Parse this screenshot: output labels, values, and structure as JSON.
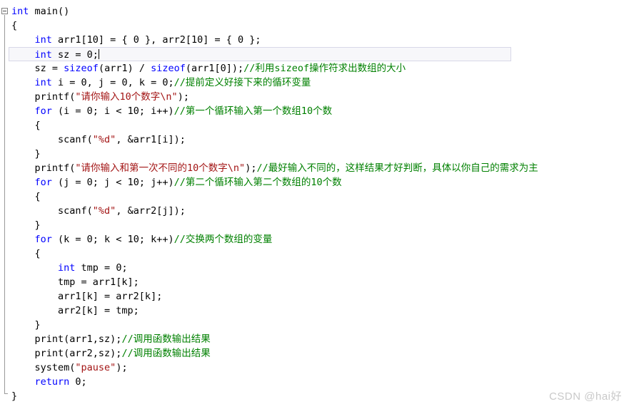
{
  "editor": {
    "language": "c",
    "colors": {
      "background": "#ffffff",
      "text": "#000000",
      "keyword": "#0000ff",
      "string": "#a31515",
      "comment": "#008000",
      "gutter_line": "#9a9a9a",
      "current_line_border": "#d8d8e8",
      "watermark": "#c9c9c9"
    },
    "outlining": {
      "collapse_label": "-",
      "expanded": true
    },
    "cursor": {
      "line": 4,
      "column": 16
    }
  },
  "watermark": {
    "text": "CSDN @hai好"
  },
  "lines": [
    {
      "n": 1,
      "tokens": [
        {
          "t": "kw",
          "s": "int"
        },
        {
          "t": "plain",
          "s": " main()"
        }
      ]
    },
    {
      "n": 2,
      "tokens": [
        {
          "t": "plain",
          "s": "{"
        }
      ]
    },
    {
      "n": 3,
      "tokens": [
        {
          "t": "plain",
          "s": "    "
        },
        {
          "t": "kw",
          "s": "int"
        },
        {
          "t": "plain",
          "s": " arr1[10] = { 0 }, arr2[10] = { 0 };"
        }
      ]
    },
    {
      "n": 4,
      "current": true,
      "tokens": [
        {
          "t": "plain",
          "s": "    "
        },
        {
          "t": "kw",
          "s": "int"
        },
        {
          "t": "plain",
          "s": " sz = 0;"
        }
      ]
    },
    {
      "n": 5,
      "tokens": [
        {
          "t": "plain",
          "s": "    sz = "
        },
        {
          "t": "kw",
          "s": "sizeof"
        },
        {
          "t": "plain",
          "s": "(arr1) / "
        },
        {
          "t": "kw",
          "s": "sizeof"
        },
        {
          "t": "plain",
          "s": "(arr1[0]);"
        },
        {
          "t": "cmt",
          "s": "//利用sizeof操作符求出数组的大小"
        }
      ]
    },
    {
      "n": 6,
      "tokens": [
        {
          "t": "plain",
          "s": "    "
        },
        {
          "t": "kw",
          "s": "int"
        },
        {
          "t": "plain",
          "s": " i = 0, j = 0, k = 0;"
        },
        {
          "t": "cmt",
          "s": "//提前定义好接下来的循环变量"
        }
      ]
    },
    {
      "n": 7,
      "tokens": [
        {
          "t": "plain",
          "s": "    printf("
        },
        {
          "t": "str",
          "s": "\"请你输入10个数字\\n\""
        },
        {
          "t": "plain",
          "s": ");"
        }
      ]
    },
    {
      "n": 8,
      "tokens": [
        {
          "t": "plain",
          "s": "    "
        },
        {
          "t": "kw",
          "s": "for"
        },
        {
          "t": "plain",
          "s": " (i = 0; i < 10; i++)"
        },
        {
          "t": "cmt",
          "s": "//第一个循环输入第一个数组10个数"
        }
      ]
    },
    {
      "n": 9,
      "tokens": [
        {
          "t": "plain",
          "s": "    {"
        }
      ]
    },
    {
      "n": 10,
      "tokens": [
        {
          "t": "plain",
          "s": "        scanf("
        },
        {
          "t": "str",
          "s": "\"%d\""
        },
        {
          "t": "plain",
          "s": ", &arr1[i]);"
        }
      ]
    },
    {
      "n": 11,
      "tokens": [
        {
          "t": "plain",
          "s": "    }"
        }
      ]
    },
    {
      "n": 12,
      "tokens": [
        {
          "t": "plain",
          "s": "    printf("
        },
        {
          "t": "str",
          "s": "\"请你输入和第一次不同的10个数字\\n\""
        },
        {
          "t": "plain",
          "s": ");"
        },
        {
          "t": "cmt",
          "s": "//最好输入不同的，这样结果才好判断，具体以你自己的需求为主"
        }
      ]
    },
    {
      "n": 13,
      "tokens": [
        {
          "t": "plain",
          "s": "    "
        },
        {
          "t": "kw",
          "s": "for"
        },
        {
          "t": "plain",
          "s": " (j = 0; j < 10; j++)"
        },
        {
          "t": "cmt",
          "s": "//第二个循环输入第二个数组的10个数"
        }
      ]
    },
    {
      "n": 14,
      "tokens": [
        {
          "t": "plain",
          "s": "    {"
        }
      ]
    },
    {
      "n": 15,
      "tokens": [
        {
          "t": "plain",
          "s": "        scanf("
        },
        {
          "t": "str",
          "s": "\"%d\""
        },
        {
          "t": "plain",
          "s": ", &arr2[j]);"
        }
      ]
    },
    {
      "n": 16,
      "tokens": [
        {
          "t": "plain",
          "s": "    }"
        }
      ]
    },
    {
      "n": 17,
      "tokens": [
        {
          "t": "plain",
          "s": "    "
        },
        {
          "t": "kw",
          "s": "for"
        },
        {
          "t": "plain",
          "s": " (k = 0; k < 10; k++)"
        },
        {
          "t": "cmt",
          "s": "//交换两个数组的变量"
        }
      ]
    },
    {
      "n": 18,
      "tokens": [
        {
          "t": "plain",
          "s": "    {"
        }
      ]
    },
    {
      "n": 19,
      "tokens": [
        {
          "t": "plain",
          "s": "        "
        },
        {
          "t": "kw",
          "s": "int"
        },
        {
          "t": "plain",
          "s": " tmp = 0;"
        }
      ]
    },
    {
      "n": 20,
      "tokens": [
        {
          "t": "plain",
          "s": "        tmp = arr1[k];"
        }
      ]
    },
    {
      "n": 21,
      "tokens": [
        {
          "t": "plain",
          "s": "        arr1[k] = arr2[k];"
        }
      ]
    },
    {
      "n": 22,
      "tokens": [
        {
          "t": "plain",
          "s": "        arr2[k] = tmp;"
        }
      ]
    },
    {
      "n": 23,
      "tokens": [
        {
          "t": "plain",
          "s": "    }"
        }
      ]
    },
    {
      "n": 24,
      "tokens": [
        {
          "t": "plain",
          "s": "    print(arr1,sz);"
        },
        {
          "t": "cmt",
          "s": "//调用函数输出结果"
        }
      ]
    },
    {
      "n": 25,
      "tokens": [
        {
          "t": "plain",
          "s": "    print(arr2,sz);"
        },
        {
          "t": "cmt",
          "s": "//调用函数输出结果"
        }
      ]
    },
    {
      "n": 26,
      "tokens": [
        {
          "t": "plain",
          "s": "    system("
        },
        {
          "t": "str",
          "s": "\"pause\""
        },
        {
          "t": "plain",
          "s": ");"
        }
      ]
    },
    {
      "n": 27,
      "tokens": [
        {
          "t": "plain",
          "s": "    "
        },
        {
          "t": "kw",
          "s": "return"
        },
        {
          "t": "plain",
          "s": " 0;"
        }
      ]
    },
    {
      "n": 28,
      "tokens": [
        {
          "t": "plain",
          "s": "}"
        }
      ]
    }
  ]
}
